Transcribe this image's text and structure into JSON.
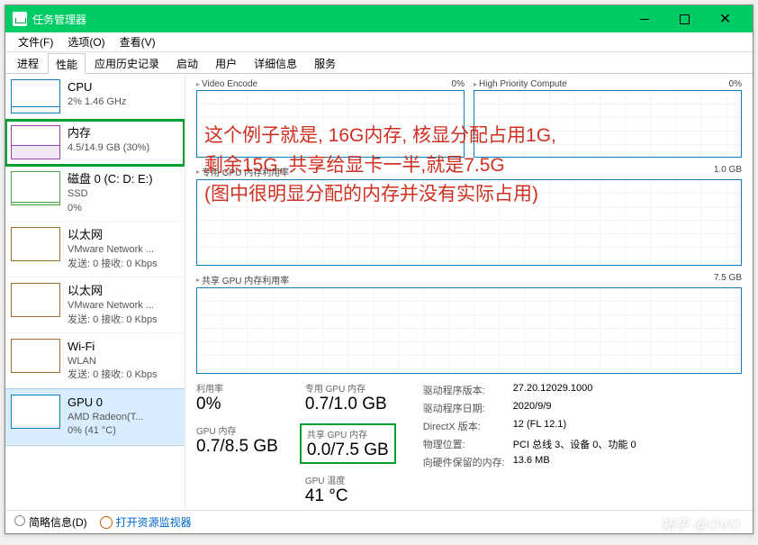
{
  "window": {
    "title": "任务管理器"
  },
  "win_buttons": {
    "close": "✕"
  },
  "menu": {
    "file": "文件(F)",
    "options": "选项(O)",
    "view": "查看(V)"
  },
  "tabs": {
    "processes": "进程",
    "performance": "性能",
    "apphistory": "应用历史记录",
    "startup": "启动",
    "users": "用户",
    "details": "详细信息",
    "services": "服务"
  },
  "sidebar": [
    {
      "title": "CPU",
      "line1": "2% 1.46 GHz",
      "thumb": "cpu"
    },
    {
      "title": "内存",
      "line1": "4.5/14.9 GB (30%)",
      "thumb": "mem",
      "highlighted": true
    },
    {
      "title": "磁盘 0 (C: D: E:)",
      "line1": "SSD",
      "line2": "0%",
      "thumb": "disk"
    },
    {
      "title": "以太网",
      "line1": "VMware Network ...",
      "line2": "发送: 0 接收: 0 Kbps",
      "thumb": "eth"
    },
    {
      "title": "以太网",
      "line1": "VMware Network ...",
      "line2": "发送: 0 接收: 0 Kbps",
      "thumb": "eth"
    },
    {
      "title": "Wi-Fi",
      "line1": "WLAN",
      "line2": "发送: 0 接收: 0 Kbps",
      "thumb": "eth"
    },
    {
      "title": "GPU 0",
      "line1": "AMD Radeon(T...",
      "line2": "0% (41 °C)",
      "thumb": "gpu",
      "selected": true
    }
  ],
  "graphs": {
    "top_left_label": "Video Encode",
    "top_left_val": "0%",
    "top_right_label": "High Priority Compute",
    "top_right_val": "0%",
    "mid_label": "专用 GPU 内存利用率",
    "mid_val": "1.0 GB",
    "bot_label": "共享 GPU 内存利用率",
    "bot_val": "7.5 GB"
  },
  "stats": {
    "util_label": "利用率",
    "util_val": "0%",
    "ded_mem_label": "专用 GPU 内存",
    "ded_mem_val": "0.7/1.0 GB",
    "gpu_mem_label": "GPU 内存",
    "gpu_mem_val": "0.7/8.5 GB",
    "shared_mem_label": "共享 GPU 内存",
    "shared_mem_val": "0.0/7.5 GB",
    "temp_label": "GPU 温度",
    "temp_val": "41 °C"
  },
  "info": {
    "driver_ver_label": "驱动程序版本:",
    "driver_ver": "27.20.12029.1000",
    "driver_date_label": "驱动程序日期:",
    "driver_date": "2020/9/9",
    "dx_label": "DirectX 版本:",
    "dx": "12 (FL 12.1)",
    "loc_label": "物理位置:",
    "loc": "PCI 总线 3、设备 0、功能 0",
    "reserved_label": "向硬件保留的内存:",
    "reserved": "13.6 MB"
  },
  "annotation": {
    "l1": "这个例子就是, 16G内存, 核显分配占用1G,",
    "l2": "剩余15G,  共享给显卡一半,就是7.5G",
    "l3": "(图中很明显分配的内存并没有实际占用)"
  },
  "statusbar": {
    "fewer": "简略信息(D)",
    "resmon": "打开资源监视器"
  },
  "watermark": "知乎 @OVO"
}
